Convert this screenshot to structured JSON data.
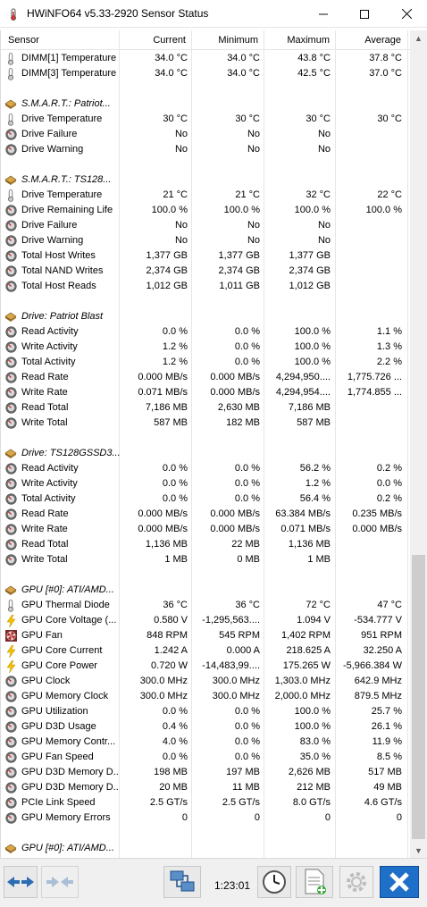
{
  "window": {
    "title": "HWiNFO64 v5.33-2920 Sensor Status",
    "colors": {
      "accent": "#2a6db3",
      "close_button_bg": "#1e6fc8"
    }
  },
  "columns": [
    "Sensor",
    "Current",
    "Minimum",
    "Maximum",
    "Average"
  ],
  "rows": [
    {
      "type": "sensor",
      "icon": "thermometer-icon",
      "name": "DIMM[1] Temperature",
      "current": "34.0 °C",
      "minimum": "34.0 °C",
      "maximum": "43.8 °C",
      "average": "37.8 °C"
    },
    {
      "type": "sensor",
      "icon": "thermometer-icon",
      "name": "DIMM[3] Temperature",
      "current": "34.0 °C",
      "minimum": "34.0 °C",
      "maximum": "42.5 °C",
      "average": "37.0 °C"
    },
    {
      "type": "blank"
    },
    {
      "type": "group",
      "icon": "drive-icon",
      "name": "S.M.A.R.T.: Patriot..."
    },
    {
      "type": "sensor",
      "icon": "thermometer-icon",
      "name": "Drive Temperature",
      "current": "30 °C",
      "minimum": "30 °C",
      "maximum": "30 °C",
      "average": "30 °C"
    },
    {
      "type": "sensor",
      "icon": "gauge-icon",
      "name": "Drive Failure",
      "current": "No",
      "minimum": "No",
      "maximum": "No",
      "average": ""
    },
    {
      "type": "sensor",
      "icon": "gauge-icon",
      "name": "Drive Warning",
      "current": "No",
      "minimum": "No",
      "maximum": "No",
      "average": ""
    },
    {
      "type": "blank"
    },
    {
      "type": "group",
      "icon": "drive-icon",
      "name": "S.M.A.R.T.: TS128..."
    },
    {
      "type": "sensor",
      "icon": "thermometer-icon",
      "name": "Drive Temperature",
      "current": "21 °C",
      "minimum": "21 °C",
      "maximum": "32 °C",
      "average": "22 °C"
    },
    {
      "type": "sensor",
      "icon": "gauge-icon",
      "name": "Drive Remaining Life",
      "current": "100.0 %",
      "minimum": "100.0 %",
      "maximum": "100.0 %",
      "average": "100.0 %"
    },
    {
      "type": "sensor",
      "icon": "gauge-icon",
      "name": "Drive Failure",
      "current": "No",
      "minimum": "No",
      "maximum": "No",
      "average": ""
    },
    {
      "type": "sensor",
      "icon": "gauge-icon",
      "name": "Drive Warning",
      "current": "No",
      "minimum": "No",
      "maximum": "No",
      "average": ""
    },
    {
      "type": "sensor",
      "icon": "gauge-icon",
      "name": "Total Host Writes",
      "current": "1,377 GB",
      "minimum": "1,377 GB",
      "maximum": "1,377 GB",
      "average": ""
    },
    {
      "type": "sensor",
      "icon": "gauge-icon",
      "name": "Total NAND Writes",
      "current": "2,374 GB",
      "minimum": "2,374 GB",
      "maximum": "2,374 GB",
      "average": ""
    },
    {
      "type": "sensor",
      "icon": "gauge-icon",
      "name": "Total Host Reads",
      "current": "1,012 GB",
      "minimum": "1,011 GB",
      "maximum": "1,012 GB",
      "average": ""
    },
    {
      "type": "blank"
    },
    {
      "type": "group",
      "icon": "drive-icon",
      "name": "Drive: Patriot Blast"
    },
    {
      "type": "sensor",
      "icon": "gauge-icon",
      "name": "Read Activity",
      "current": "0.0 %",
      "minimum": "0.0 %",
      "maximum": "100.0 %",
      "average": "1.1 %"
    },
    {
      "type": "sensor",
      "icon": "gauge-icon",
      "name": "Write Activity",
      "current": "1.2 %",
      "minimum": "0.0 %",
      "maximum": "100.0 %",
      "average": "1.3 %"
    },
    {
      "type": "sensor",
      "icon": "gauge-icon",
      "name": "Total Activity",
      "current": "1.2 %",
      "minimum": "0.0 %",
      "maximum": "100.0 %",
      "average": "2.2 %"
    },
    {
      "type": "sensor",
      "icon": "gauge-icon",
      "name": "Read Rate",
      "current": "0.000 MB/s",
      "minimum": "0.000 MB/s",
      "maximum": "4,294,950....",
      "average": "1,775.726 ..."
    },
    {
      "type": "sensor",
      "icon": "gauge-icon",
      "name": "Write Rate",
      "current": "0.071 MB/s",
      "minimum": "0.000 MB/s",
      "maximum": "4,294,954....",
      "average": "1,774.855 ..."
    },
    {
      "type": "sensor",
      "icon": "gauge-icon",
      "name": "Read Total",
      "current": "7,186 MB",
      "minimum": "2,630 MB",
      "maximum": "7,186 MB",
      "average": ""
    },
    {
      "type": "sensor",
      "icon": "gauge-icon",
      "name": "Write Total",
      "current": "587 MB",
      "minimum": "182 MB",
      "maximum": "587 MB",
      "average": ""
    },
    {
      "type": "blank"
    },
    {
      "type": "group",
      "icon": "drive-icon",
      "name": "Drive: TS128GSSD3..."
    },
    {
      "type": "sensor",
      "icon": "gauge-icon",
      "name": "Read Activity",
      "current": "0.0 %",
      "minimum": "0.0 %",
      "maximum": "56.2 %",
      "average": "0.2 %"
    },
    {
      "type": "sensor",
      "icon": "gauge-icon",
      "name": "Write Activity",
      "current": "0.0 %",
      "minimum": "0.0 %",
      "maximum": "1.2 %",
      "average": "0.0 %"
    },
    {
      "type": "sensor",
      "icon": "gauge-icon",
      "name": "Total Activity",
      "current": "0.0 %",
      "minimum": "0.0 %",
      "maximum": "56.4 %",
      "average": "0.2 %"
    },
    {
      "type": "sensor",
      "icon": "gauge-icon",
      "name": "Read Rate",
      "current": "0.000 MB/s",
      "minimum": "0.000 MB/s",
      "maximum": "63.384 MB/s",
      "average": "0.235 MB/s"
    },
    {
      "type": "sensor",
      "icon": "gauge-icon",
      "name": "Write Rate",
      "current": "0.000 MB/s",
      "minimum": "0.000 MB/s",
      "maximum": "0.071 MB/s",
      "average": "0.000 MB/s"
    },
    {
      "type": "sensor",
      "icon": "gauge-icon",
      "name": "Read Total",
      "current": "1,136 MB",
      "minimum": "22 MB",
      "maximum": "1,136 MB",
      "average": ""
    },
    {
      "type": "sensor",
      "icon": "gauge-icon",
      "name": "Write Total",
      "current": "1 MB",
      "minimum": "0 MB",
      "maximum": "1 MB",
      "average": ""
    },
    {
      "type": "blank"
    },
    {
      "type": "group",
      "icon": "gpu-icon",
      "name": "GPU [#0]: ATI/AMD..."
    },
    {
      "type": "sensor",
      "icon": "thermometer-icon",
      "name": "GPU Thermal Diode",
      "current": "36 °C",
      "minimum": "36 °C",
      "maximum": "72 °C",
      "average": "47 °C"
    },
    {
      "type": "sensor",
      "icon": "lightning-icon",
      "name": "GPU Core Voltage (...",
      "current": "0.580 V",
      "minimum": "-1,295,563....",
      "maximum": "1.094 V",
      "average": "-534.777 V"
    },
    {
      "type": "sensor",
      "icon": "fan-icon",
      "name": "GPU Fan",
      "current": "848 RPM",
      "minimum": "545 RPM",
      "maximum": "1,402 RPM",
      "average": "951 RPM"
    },
    {
      "type": "sensor",
      "icon": "lightning-icon",
      "name": "GPU Core Current",
      "current": "1.242 A",
      "minimum": "0.000 A",
      "maximum": "218.625 A",
      "average": "32.250 A"
    },
    {
      "type": "sensor",
      "icon": "lightning-icon",
      "name": "GPU Core Power",
      "current": "0.720 W",
      "minimum": "-14,483,99....",
      "maximum": "175.265 W",
      "average": "-5,966.384 W"
    },
    {
      "type": "sensor",
      "icon": "gauge-icon",
      "name": "GPU Clock",
      "current": "300.0 MHz",
      "minimum": "300.0 MHz",
      "maximum": "1,303.0 MHz",
      "average": "642.9 MHz"
    },
    {
      "type": "sensor",
      "icon": "gauge-icon",
      "name": "GPU Memory Clock",
      "current": "300.0 MHz",
      "minimum": "300.0 MHz",
      "maximum": "2,000.0 MHz",
      "average": "879.5 MHz"
    },
    {
      "type": "sensor",
      "icon": "gauge-icon",
      "name": "GPU Utilization",
      "current": "0.0 %",
      "minimum": "0.0 %",
      "maximum": "100.0 %",
      "average": "25.7 %"
    },
    {
      "type": "sensor",
      "icon": "gauge-icon",
      "name": "GPU D3D Usage",
      "current": "0.4 %",
      "minimum": "0.0 %",
      "maximum": "100.0 %",
      "average": "26.1 %"
    },
    {
      "type": "sensor",
      "icon": "gauge-icon",
      "name": "GPU Memory Contr...",
      "current": "4.0 %",
      "minimum": "0.0 %",
      "maximum": "83.0 %",
      "average": "11.9 %"
    },
    {
      "type": "sensor",
      "icon": "gauge-icon",
      "name": "GPU Fan Speed",
      "current": "0.0 %",
      "minimum": "0.0 %",
      "maximum": "35.0 %",
      "average": "8.5 %"
    },
    {
      "type": "sensor",
      "icon": "gauge-icon",
      "name": "GPU D3D Memory D...",
      "current": "198 MB",
      "minimum": "197 MB",
      "maximum": "2,626 MB",
      "average": "517 MB"
    },
    {
      "type": "sensor",
      "icon": "gauge-icon",
      "name": "GPU D3D Memory D...",
      "current": "20 MB",
      "minimum": "11 MB",
      "maximum": "212 MB",
      "average": "49 MB"
    },
    {
      "type": "sensor",
      "icon": "gauge-icon",
      "name": "PCIe Link Speed",
      "current": "2.5 GT/s",
      "minimum": "2.5 GT/s",
      "maximum": "8.0 GT/s",
      "average": "4.6 GT/s"
    },
    {
      "type": "sensor",
      "icon": "gauge-icon",
      "name": "GPU Memory Errors",
      "current": "0",
      "minimum": "0",
      "maximum": "0",
      "average": "0"
    },
    {
      "type": "blank"
    },
    {
      "type": "group",
      "icon": "gpu-icon",
      "name": "GPU [#0]: ATI/AMD..."
    }
  ],
  "toolbar": {
    "timer": "1:23:01",
    "buttons": [
      "expand-collapse-icon",
      "expand-collapse-disabled-icon",
      "network-icon",
      "clock-icon",
      "logging-icon",
      "settings-icon",
      "close-icon"
    ]
  }
}
